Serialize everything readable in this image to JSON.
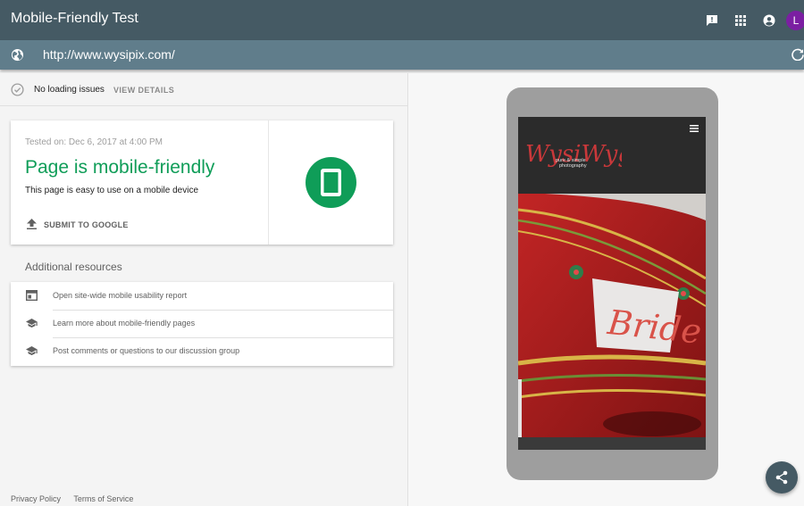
{
  "app": {
    "title": "Mobile-Friendly Test",
    "avatar_initial": "L",
    "avatar_color": "#7b1fa2",
    "icons": [
      "feedback-icon",
      "apps-grid-icon",
      "account-circle-icon"
    ]
  },
  "url_bar": {
    "url": "http://www.wysipix.com/",
    "icons": [
      "globe-icon",
      "refresh-icon"
    ]
  },
  "status": {
    "text": "No loading issues",
    "action": "VIEW DETAILS"
  },
  "result": {
    "tested_on": "Tested on: Dec 6, 2017 at 4:00 PM",
    "title": "Page is mobile-friendly",
    "description": "This page is easy to use on a mobile device",
    "submit_label": "SUBMIT TO GOOGLE",
    "accent_color": "#0f9d58"
  },
  "resources": {
    "title": "Additional resources",
    "items": [
      {
        "label": "Open site-wide mobile usability report",
        "icon": "web-report-icon"
      },
      {
        "label": "Learn more about mobile-friendly pages",
        "icon": "school-icon"
      },
      {
        "label": "Post comments or questions to our discussion group",
        "icon": "school-icon"
      }
    ]
  },
  "footer": {
    "privacy": "Privacy Policy",
    "terms": "Terms of Service"
  },
  "preview": {
    "logo_text": "WysiWyg",
    "logo_tagline_1": "pure & simple",
    "logo_tagline_2": "photography",
    "hero_sign_text": "Bride"
  },
  "colors": {
    "appbar": "#455a64",
    "urlbar": "#607d8b",
    "phone_frame": "#9e9e9e"
  }
}
